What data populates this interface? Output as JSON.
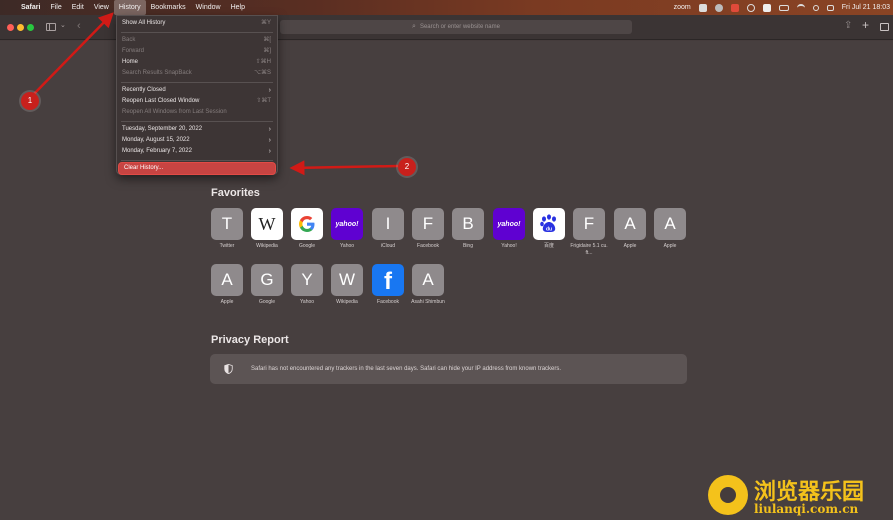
{
  "menubar": {
    "apple_symbol": "",
    "app_name": "Safari",
    "menus": [
      "File",
      "Edit",
      "View",
      "History",
      "Bookmarks",
      "Window",
      "Help"
    ],
    "active_menu": "History",
    "status": {
      "zoom": "zoom",
      "clock": "Fri Jul 21  18:03"
    }
  },
  "toolbar": {
    "address_placeholder": "Search or enter website name",
    "new_tab_symbol": "+"
  },
  "history_menu": {
    "items": [
      {
        "label": "Show All History",
        "shortcut": "⌘Y",
        "enabled": true
      },
      {
        "label": "Back",
        "shortcut": "⌘[",
        "enabled": false
      },
      {
        "label": "Forward",
        "shortcut": "⌘]",
        "enabled": false
      },
      {
        "label": "Home",
        "shortcut": "⇧⌘H",
        "enabled": true
      },
      {
        "label": "Search Results SnapBack",
        "shortcut": "⌥⌘S",
        "enabled": false
      },
      {
        "label": "Recently Closed",
        "submenu": true,
        "enabled": true
      },
      {
        "label": "Reopen Last Closed Window",
        "shortcut": "⇧⌘T",
        "enabled": true
      },
      {
        "label": "Reopen All Windows from Last Session",
        "enabled": false
      },
      {
        "label": "Tuesday, September 20, 2022",
        "submenu": true,
        "enabled": true
      },
      {
        "label": "Monday, August 15, 2022",
        "submenu": true,
        "enabled": true
      },
      {
        "label": "Monday, February 7, 2022",
        "submenu": true,
        "enabled": true
      },
      {
        "label": "Clear History...",
        "enabled": true,
        "highlighted": true
      }
    ],
    "submenu_arrow": "›"
  },
  "favorites": {
    "title": "Favorites",
    "row1": [
      {
        "label": "Twitter",
        "glyph": "T"
      },
      {
        "label": "Wikipedia",
        "glyph": "W"
      },
      {
        "label": "Google",
        "glyph": "G"
      },
      {
        "label": "Yahoo",
        "glyph": "yahoo!"
      },
      {
        "label": "iCloud",
        "glyph": "I"
      },
      {
        "label": "Facebook",
        "glyph": "F"
      },
      {
        "label": "Bing",
        "glyph": "B"
      },
      {
        "label": "Yahoo!",
        "glyph": "yahoo!"
      },
      {
        "label": "百度",
        "glyph": "du"
      },
      {
        "label": "Frigidaire 5.1 cu. ft...",
        "glyph": "F"
      },
      {
        "label": "Apple",
        "glyph": "A"
      },
      {
        "label": "Apple",
        "glyph": "A"
      }
    ],
    "row2": [
      {
        "label": "Apple",
        "glyph": "A"
      },
      {
        "label": "Google",
        "glyph": "G"
      },
      {
        "label": "Yahoo",
        "glyph": "Y"
      },
      {
        "label": "Wikipedia",
        "glyph": "W"
      },
      {
        "label": "Facebook",
        "glyph": "f"
      },
      {
        "label": "Asahi Shimbun",
        "glyph": "A"
      }
    ]
  },
  "privacy": {
    "title": "Privacy Report",
    "message": "Safari has not encountered any trackers in the last seven days. Safari can hide your IP address from known trackers."
  },
  "annotations": {
    "badge1": "1",
    "badge2": "2"
  },
  "watermark": {
    "title": "浏览器乐园",
    "url": "liulanqi.com.cn"
  },
  "colors": {
    "highlight": "#c74442",
    "annotation": "#d11a16",
    "watermark": "#f4c21b",
    "yahoo": "#5f01d1",
    "facebook": "#1877f2"
  }
}
